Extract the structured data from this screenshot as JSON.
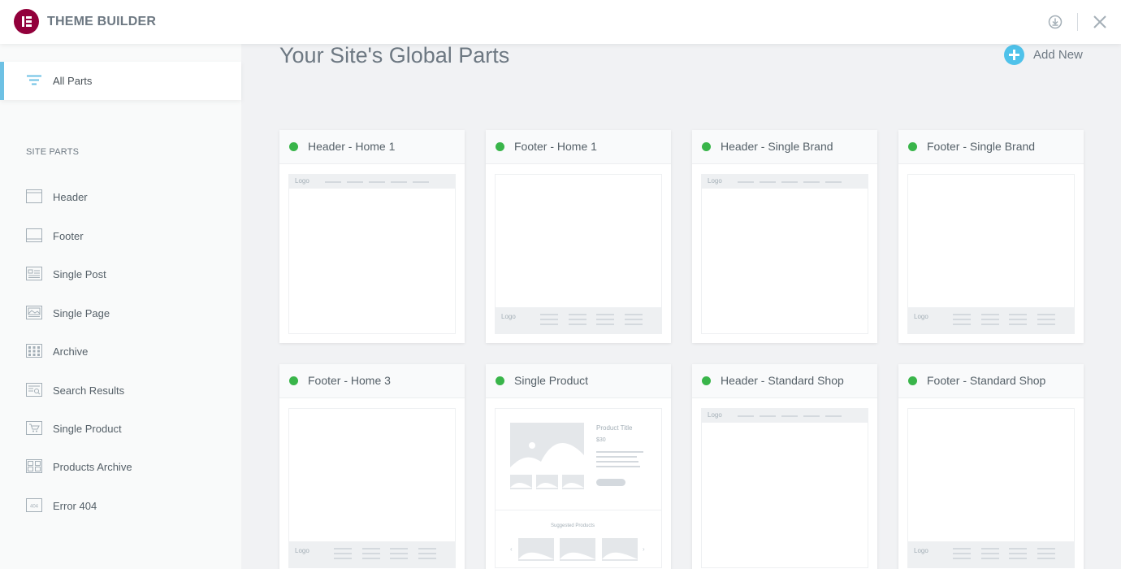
{
  "app": {
    "title": "THEME BUILDER",
    "logo_icon": "elementor-logo-icon"
  },
  "topbar_icons": [
    "download-icon",
    "close-icon"
  ],
  "sidebar": {
    "all_parts_label": "All Parts",
    "section_title": "SITE PARTS",
    "items": [
      {
        "label": "Header",
        "icon": "header-icon"
      },
      {
        "label": "Footer",
        "icon": "footer-icon"
      },
      {
        "label": "Single Post",
        "icon": "single-post-icon"
      },
      {
        "label": "Single Page",
        "icon": "single-page-icon"
      },
      {
        "label": "Archive",
        "icon": "archive-icon"
      },
      {
        "label": "Search Results",
        "icon": "search-results-icon"
      },
      {
        "label": "Single Product",
        "icon": "single-product-icon"
      },
      {
        "label": "Products Archive",
        "icon": "products-archive-icon"
      },
      {
        "label": "Error 404",
        "icon": "error-404-icon"
      }
    ]
  },
  "main": {
    "title": "Your Site's Global Parts",
    "add_new_label": "Add New",
    "cards": [
      {
        "title": "Header - Home 1",
        "type": "header",
        "status": "active"
      },
      {
        "title": "Footer - Home 1",
        "type": "footer",
        "status": "active"
      },
      {
        "title": "Header - Single Brand",
        "type": "header",
        "status": "active"
      },
      {
        "title": "Footer - Single Brand",
        "type": "footer",
        "status": "active"
      },
      {
        "title": "Footer - Home 3",
        "type": "footer",
        "status": "active"
      },
      {
        "title": "Single Product",
        "type": "product",
        "status": "active"
      },
      {
        "title": "Header - Standard Shop",
        "type": "header",
        "status": "active"
      },
      {
        "title": "Footer - Standard Shop",
        "type": "footer",
        "status": "active"
      }
    ],
    "preview": {
      "logo_text": "Logo",
      "product_title": "Product Title",
      "product_price": "$30",
      "suggested_label": "Suggested Products"
    }
  },
  "colors": {
    "accent": "#6ec1e4",
    "brand": "#92003b",
    "status_active": "#39b54a",
    "add_button": "#4fc2ea"
  }
}
